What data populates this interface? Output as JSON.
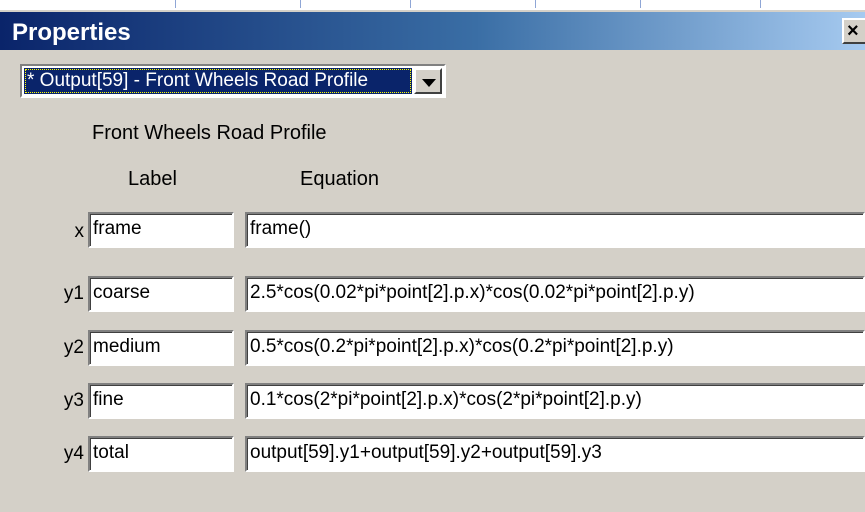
{
  "window": {
    "title": "Properties"
  },
  "selector": {
    "value": "* Output[59] - Front Wheels Road Profile"
  },
  "panel": {
    "heading": "Front Wheels Road Profile",
    "col_label": "Label",
    "col_equation": "Equation"
  },
  "rows": [
    {
      "var": "x",
      "label": "frame",
      "equation": "frame()"
    },
    {
      "var": "y1",
      "label": "coarse",
      "equation": "2.5*cos(0.02*pi*point[2].p.x)*cos(0.02*pi*point[2].p.y)"
    },
    {
      "var": "y2",
      "label": "medium",
      "equation": "0.5*cos(0.2*pi*point[2].p.x)*cos(0.2*pi*point[2].p.y)"
    },
    {
      "var": "y3",
      "label": "fine",
      "equation": "0.1*cos(2*pi*point[2].p.x)*cos(2*pi*point[2].p.y)"
    },
    {
      "var": "y4",
      "label": "total",
      "equation": "output[59].y1+output[59].y2+output[59].y3"
    }
  ],
  "colors": {
    "titlebar_start": "#0a246a",
    "titlebar_end": "#a6caf0",
    "face": "#d4d0c8"
  },
  "icons": {
    "close": "close-icon",
    "dropdown": "dropdown-arrow-icon"
  }
}
